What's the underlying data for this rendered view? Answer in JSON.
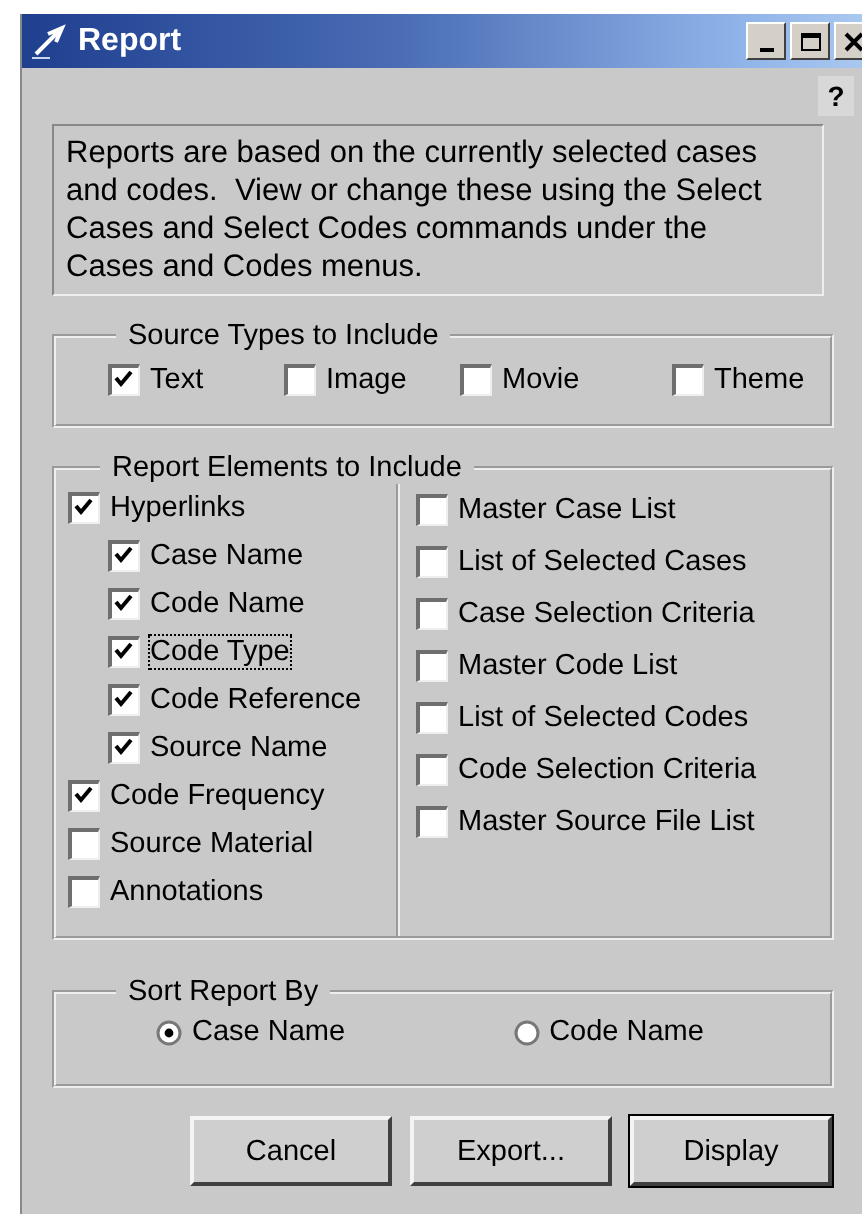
{
  "window": {
    "title": "Report"
  },
  "help_button": "?",
  "info_text": "Reports are based on the currently selected cases and codes.  View or change these using the Select Cases and Select Codes commands under the Cases and Codes menus.",
  "source_types": {
    "title": "Source Types to Include",
    "items": [
      {
        "label": "Text",
        "checked": true
      },
      {
        "label": "Image",
        "checked": false
      },
      {
        "label": "Movie",
        "checked": false
      },
      {
        "label": "Theme",
        "checked": false
      }
    ]
  },
  "report_elements": {
    "title": "Report Elements to Include",
    "left": [
      {
        "label": "Hyperlinks",
        "checked": true,
        "focused": false,
        "children": [
          {
            "label": "Case Name",
            "checked": true,
            "focused": false
          },
          {
            "label": "Code Name",
            "checked": true,
            "focused": false
          },
          {
            "label": "Code Type",
            "checked": true,
            "focused": true
          },
          {
            "label": "Code Reference",
            "checked": true,
            "focused": false
          },
          {
            "label": "Source Name",
            "checked": true,
            "focused": false
          }
        ]
      },
      {
        "label": "Code Frequency",
        "checked": true,
        "focused": false
      },
      {
        "label": "Source Material",
        "checked": false,
        "focused": false
      },
      {
        "label": "Annotations",
        "checked": false,
        "focused": false
      }
    ],
    "right": [
      {
        "label": "Master Case List",
        "checked": false
      },
      {
        "label": "List of Selected Cases",
        "checked": false
      },
      {
        "label": "Case Selection Criteria",
        "checked": false
      },
      {
        "label": "Master Code List",
        "checked": false
      },
      {
        "label": "List of Selected Codes",
        "checked": false
      },
      {
        "label": "Code Selection Criteria",
        "checked": false
      },
      {
        "label": "Master Source File List",
        "checked": false
      }
    ]
  },
  "sort": {
    "title": "Sort Report By",
    "options": [
      {
        "label": "Case Name",
        "selected": true
      },
      {
        "label": "Code Name",
        "selected": false
      }
    ]
  },
  "buttons": [
    {
      "label": "Cancel",
      "default": false
    },
    {
      "label": "Export...",
      "default": false
    },
    {
      "label": "Display",
      "default": true
    }
  ]
}
